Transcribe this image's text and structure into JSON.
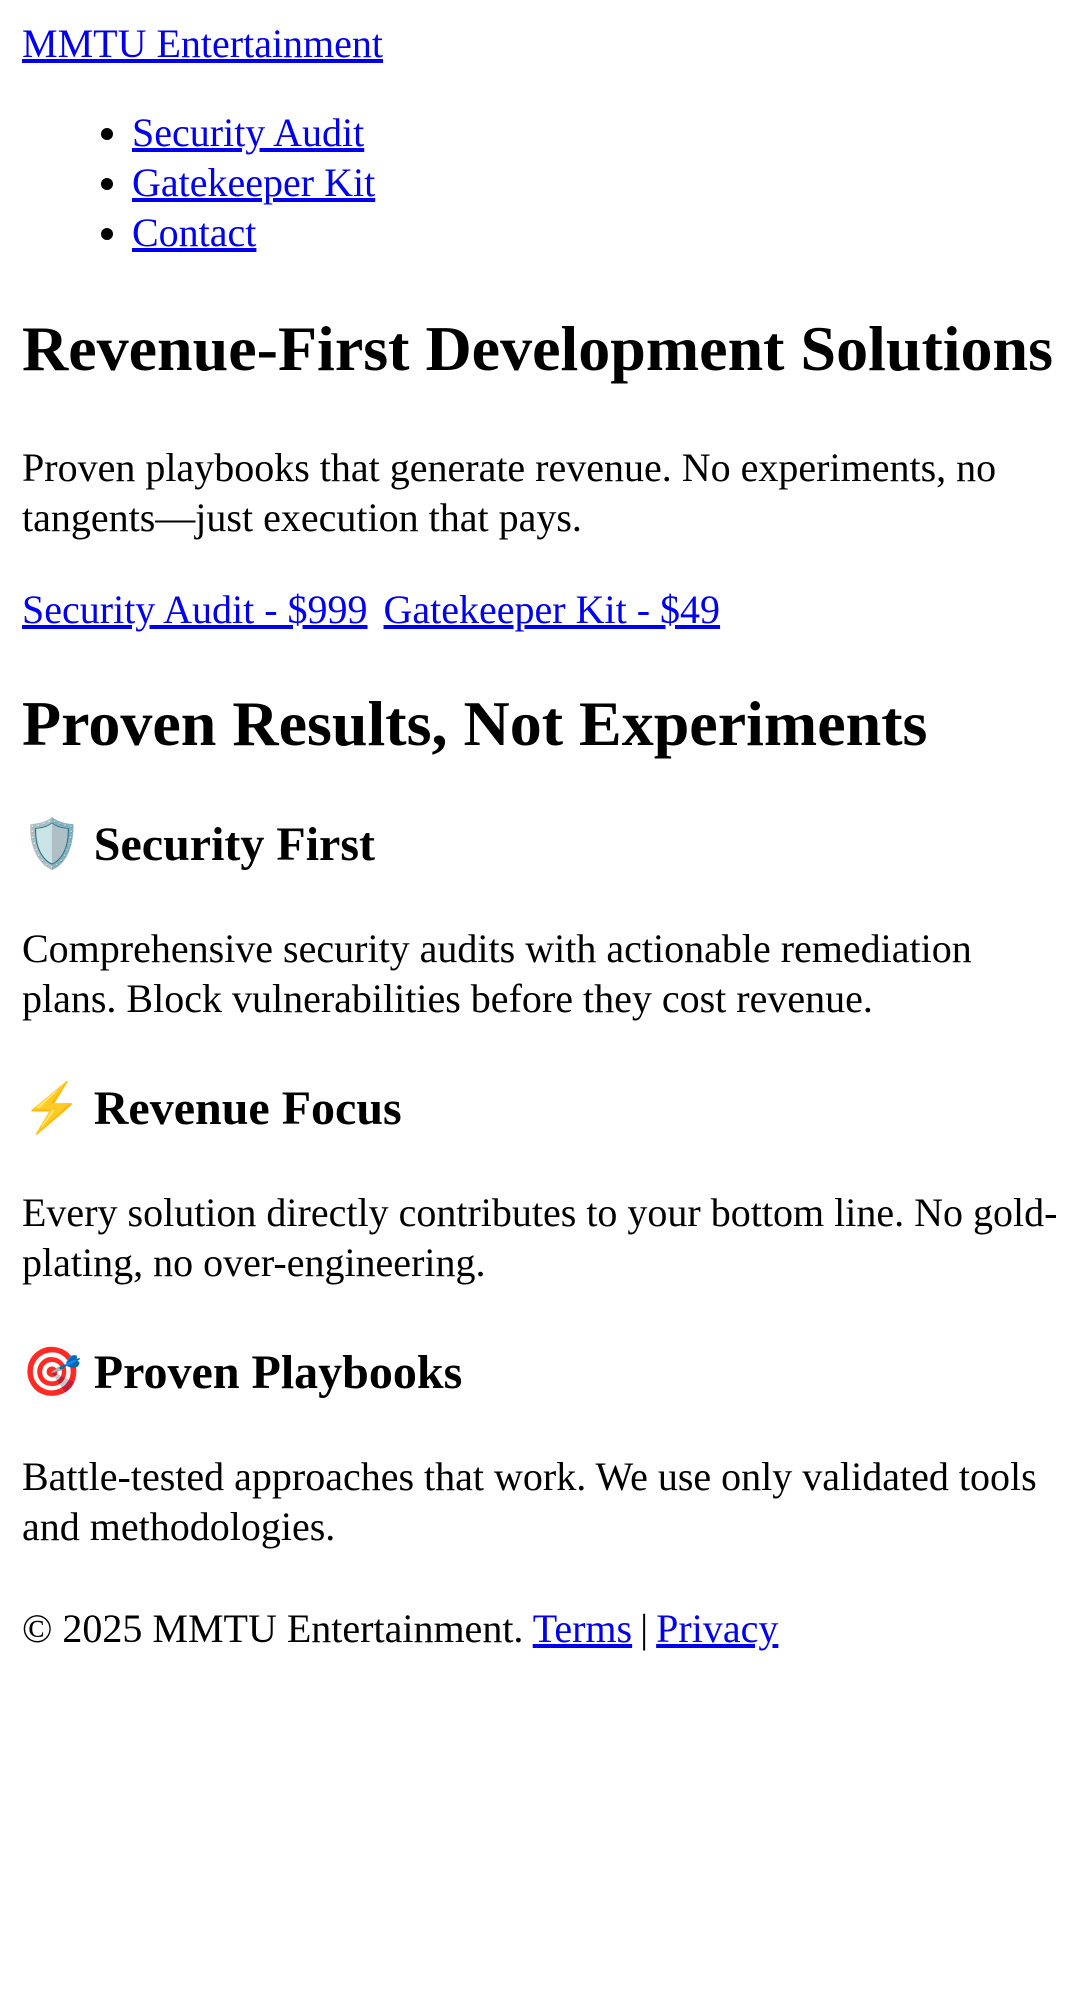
{
  "header": {
    "brand": "MMTU Entertainment"
  },
  "nav": {
    "items": [
      {
        "label": "Security Audit"
      },
      {
        "label": "Gatekeeper Kit"
      },
      {
        "label": "Contact"
      }
    ]
  },
  "hero": {
    "title": "Revenue-First Development Solutions",
    "subtitle": "Proven playbooks that generate revenue. No experiments, no tangents—just execution that pays.",
    "cta_primary": "Security Audit - $999",
    "cta_secondary": "Gatekeeper Kit - $49"
  },
  "results": {
    "title": "Proven Results, Not Experiments",
    "features": [
      {
        "icon": "shield-icon",
        "glyph": "🛡️",
        "title": "Security First",
        "text": "Comprehensive security audits with actionable remediation plans. Block vulnerabilities before they cost revenue."
      },
      {
        "icon": "lightning-icon",
        "glyph": "⚡",
        "title": "Revenue Focus",
        "text": "Every solution directly contributes to your bottom line. No gold-plating, no over-engineering."
      },
      {
        "icon": "target-icon",
        "glyph": "🎯",
        "title": "Proven Playbooks",
        "text": "Battle-tested approaches that work. We use only validated tools and methodologies."
      }
    ]
  },
  "footer": {
    "copyright": "© 2025 MMTU Entertainment.",
    "terms": "Terms",
    "separator": "|",
    "privacy": "Privacy"
  },
  "colors": {
    "link": "#0000ee",
    "text": "#000000",
    "background": "#ffffff"
  }
}
